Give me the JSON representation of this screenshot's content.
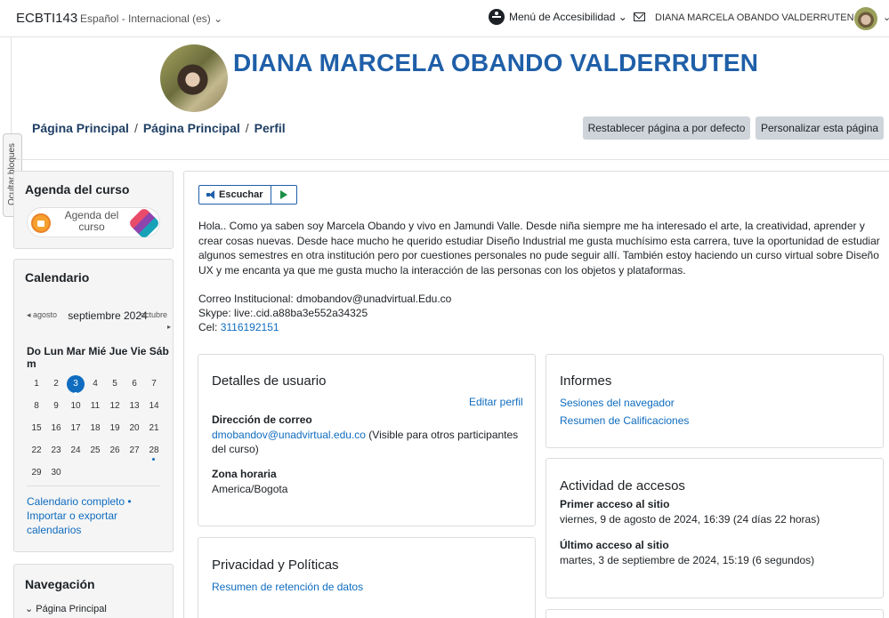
{
  "navbar": {
    "brand": "ECBTI143",
    "language": "Español - Internacional (es) ⌄",
    "accessibility_menu": "Menú de Accesibilidad ⌄",
    "user_name": "DIANA MARCELA OBANDO VALDERRUTEN",
    "user_menu_caret": "⌄"
  },
  "hide_blocks_label": "Ocultar bloques",
  "header": {
    "title": "DIANA MARCELA OBANDO VALDERRUTEN",
    "breadcrumb": [
      "Página Principal",
      "Página Principal",
      "Perfil"
    ],
    "breadcrumb_separator": "/",
    "reset_button": "Restablecer página a por defecto",
    "customize_button": "Personalizar esta página"
  },
  "agenda": {
    "title": "Agenda del curso",
    "button_text": "Agenda del curso"
  },
  "calendar": {
    "title": "Calendario",
    "prev_month": "agosto",
    "current_month": "septiembre 2024",
    "next_month": "octubre",
    "weekday_header": "Do Lun Mar Mié Jue Vie Sáb",
    "weekday_header_wrap": "m",
    "weeks": [
      [
        "1",
        "2",
        "3",
        "4",
        "5",
        "6",
        "7"
      ],
      [
        "8",
        "9",
        "10",
        "11",
        "12",
        "13",
        "14"
      ],
      [
        "15",
        "16",
        "17",
        "18",
        "19",
        "20",
        "21"
      ],
      [
        "22",
        "23",
        "24",
        "25",
        "26",
        "27",
        "28"
      ],
      [
        "29",
        "30",
        "",
        "",
        "",
        "",
        ""
      ]
    ],
    "today": "3",
    "event_day": "28",
    "links_text": "Calendario completo • Importar o exportar calendarios"
  },
  "navigation": {
    "title": "Navegación",
    "first_item": "⌄ Página Principal"
  },
  "main": {
    "listen_label": "Escuchar",
    "bio": "Hola.. Como ya saben soy Marcela Obando y vivo en Jamundi Valle. Desde niña siempre me ha interesado el arte, la creatividad, aprender y crear cosas nuevas. Desde hace mucho he querido estudiar Diseño Industrial me gusta muchísimo esta carrera, tuve la oportunidad de estudiar algunos semestres en otra institución pero por cuestiones personales no pude seguir allí. También estoy haciendo un curso virtual sobre Diseño UX y me encanta ya que me gusta mucho la interacción de las personas con los objetos y plataformas.",
    "contact_email": "Correo Institucional: dmobandov@unadvirtual.Edu.co",
    "contact_skype": "Skype: live:.cid.a88ba3e552a34325",
    "contact_phone_label": "Cel: ",
    "contact_phone": "3116192151"
  },
  "user_details": {
    "title": "Detalles de usuario",
    "edit_profile": "Editar perfil",
    "email_label": "Dirección de correo",
    "email_value": "dmobandov@unadvirtual.edu.co",
    "email_note": " (Visible para otros participantes del curso)",
    "timezone_label": "Zona horaria",
    "timezone_value": "America/Bogota"
  },
  "privacy": {
    "title": "Privacidad y Políticas",
    "retention_link": "Resumen de retención de datos"
  },
  "reports": {
    "title": "Informes",
    "browser_sessions": "Sesiones del navegador",
    "grades_summary": "Resumen de Calificaciones"
  },
  "access_activity": {
    "title": "Actividad de accesos",
    "first_access_label": "Primer acceso al sitio",
    "first_access_value": "viernes, 9 de agosto de 2024, 16:39  (24 días 22 horas)",
    "last_access_label": "Último acceso al sitio",
    "last_access_value": "martes, 3 de septiembre de 2024, 15:19  (6 segundos)"
  }
}
